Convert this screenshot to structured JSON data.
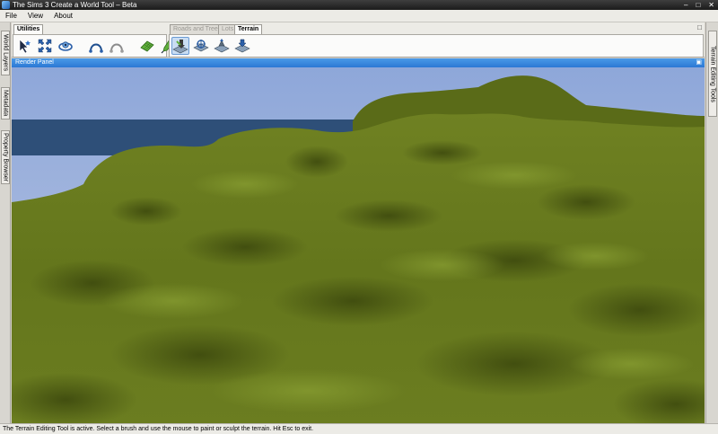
{
  "window": {
    "title": "The Sims 3 Create a World Tool – Beta",
    "minimize": "–",
    "maximize": "□",
    "close": "✕"
  },
  "menu": {
    "items": [
      "File",
      "View",
      "About"
    ]
  },
  "left_panels": [
    "World Layers",
    "Metadata",
    "Property Browser"
  ],
  "right_panels": [
    "Terrain Editing Tools"
  ],
  "ribbon": {
    "tab_utilities": "Utilities",
    "tab_roads_trees": "Roads and Trees",
    "tab_lots": "Lots",
    "tab_terrain": "Terrain",
    "utility_icons": [
      "select-arrow-icon",
      "move-icon",
      "camera-orbit-icon",
      "curve-icon",
      "curve-alt-icon",
      "grid-icon",
      "paint-icon"
    ],
    "terrain_icons": [
      "terrain-sculpt-icon",
      "terrain-paint-icon",
      "terrain-raise-icon",
      "terrain-lower-icon"
    ],
    "collapse_glyph": "□"
  },
  "render_panel": {
    "title": "Render Panel",
    "pin_glyph": "▣"
  },
  "status": {
    "text": "The Terrain Editing Tool is active. Select a brush and use the mouse to paint or sculpt the terrain. Hit Esc to exit."
  },
  "colors": {
    "sky_top": "#8da8da",
    "sky_bottom": "#b9c6e4",
    "water": "#2d4f78",
    "terrain": "#6c7d1f",
    "panel_header": "#3a8ae0"
  }
}
